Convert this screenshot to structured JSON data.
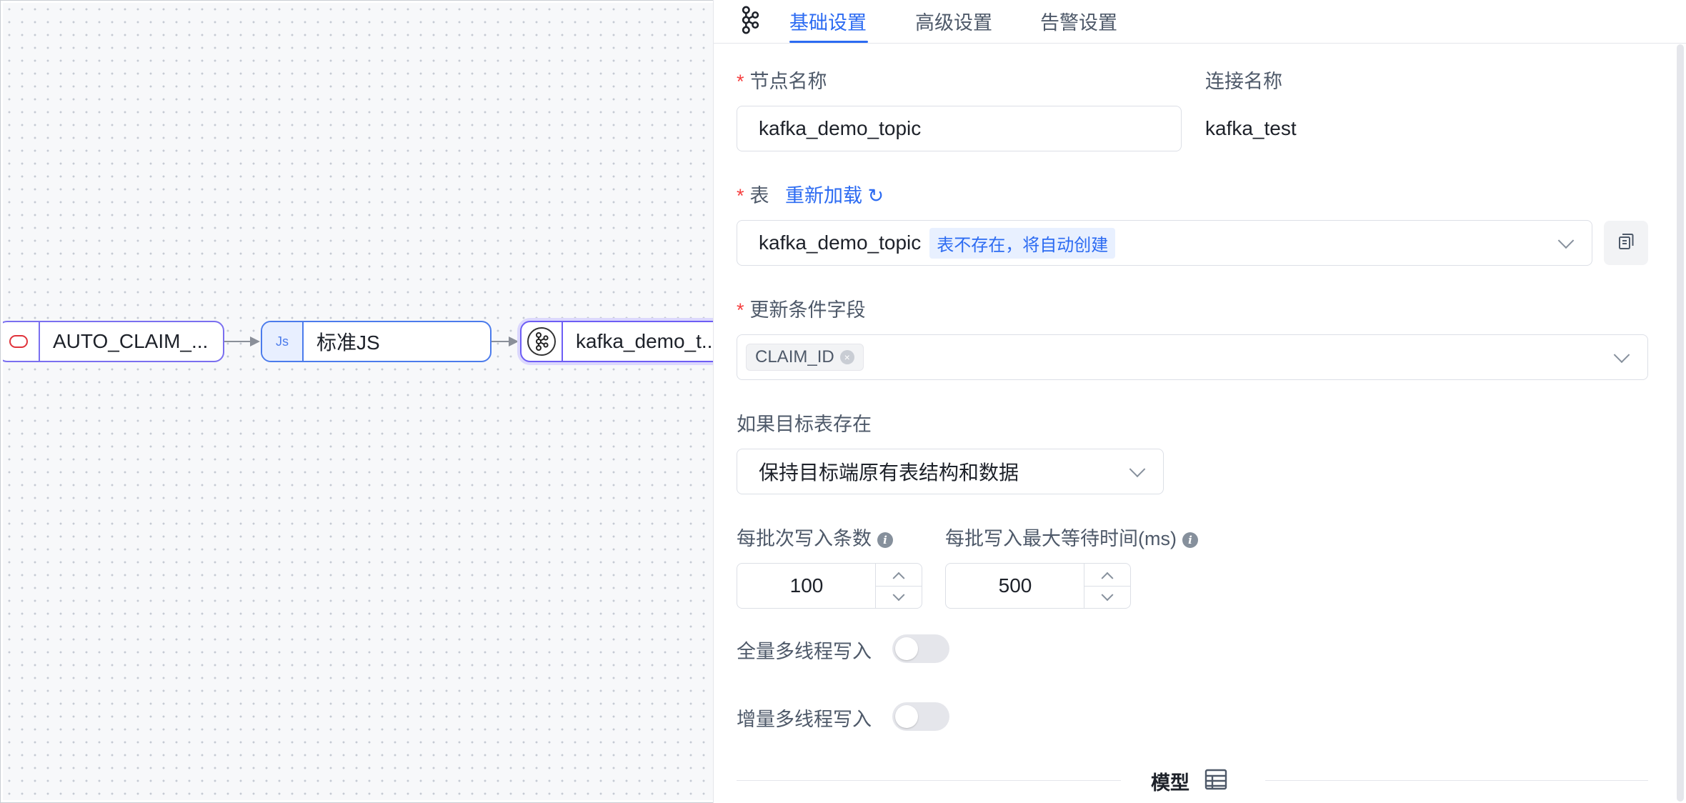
{
  "canvas": {
    "nodes": [
      {
        "label": "AUTO_CLAIM_...",
        "icon": "oracle-icon"
      },
      {
        "label": "标准JS",
        "icon_text": "Js"
      },
      {
        "label": "kafka_demo_t...",
        "icon": "kafka-icon"
      }
    ]
  },
  "tabs": [
    {
      "label": "基础设置",
      "active": true
    },
    {
      "label": "高级设置",
      "active": false
    },
    {
      "label": "告警设置",
      "active": false
    }
  ],
  "form": {
    "required_mark": "*",
    "node_name": {
      "label": "节点名称",
      "value": "kafka_demo_topic"
    },
    "connection": {
      "label": "连接名称",
      "value": "kafka_test"
    },
    "table": {
      "label": "表",
      "reload_label": "重新加载",
      "value": "kafka_demo_topic",
      "tag": "表不存在，将自动创建"
    },
    "update_fields": {
      "label": "更新条件字段",
      "chips": [
        "CLAIM_ID"
      ]
    },
    "if_exists": {
      "label": "如果目标表存在",
      "value": "保持目标端原有表结构和数据"
    },
    "batch_count": {
      "label": "每批次写入条数",
      "value": "100"
    },
    "batch_wait": {
      "label": "每批写入最大等待时间(ms)",
      "value": "500"
    },
    "full_multithread": {
      "label": "全量多线程写入",
      "enabled": false
    },
    "incr_multithread": {
      "label": "增量多线程写入",
      "enabled": false
    },
    "model_section": {
      "label": "模型"
    }
  },
  "colors": {
    "accent": "#2c6bf2",
    "node_border": "#7a6ff0",
    "required": "#f53f3f"
  }
}
